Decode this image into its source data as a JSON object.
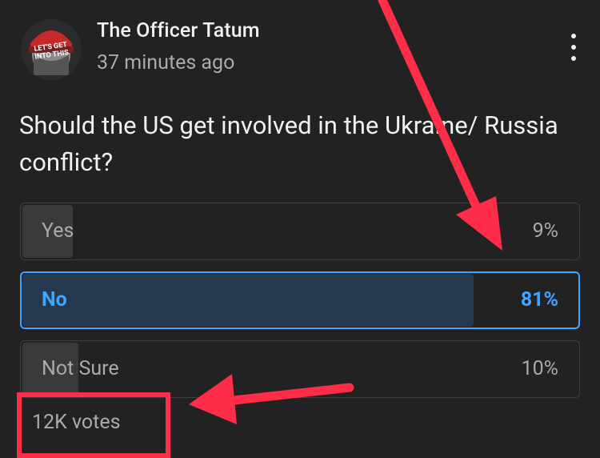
{
  "post": {
    "author": "The Officer Tatum",
    "time": "37 minutes ago",
    "avatar_text_1": "LET'S GET",
    "avatar_text_2": "INTO THIS",
    "menu_icon": "more-vert-icon"
  },
  "poll": {
    "question": "Should the US get involved in the Ukraine/ Russia conflict?",
    "options": [
      {
        "label": "Yes",
        "percent": "9%",
        "fraction": 0.09,
        "selected": false
      },
      {
        "label": "No",
        "percent": "81%",
        "fraction": 0.81,
        "selected": true
      },
      {
        "label": "Not Sure",
        "percent": "10%",
        "fraction": 0.1,
        "selected": false
      }
    ],
    "votes": "12K votes"
  },
  "colors": {
    "background": "#222222",
    "selected_accent": "#3ea6ff",
    "annotation_red": "#ff2d48"
  }
}
